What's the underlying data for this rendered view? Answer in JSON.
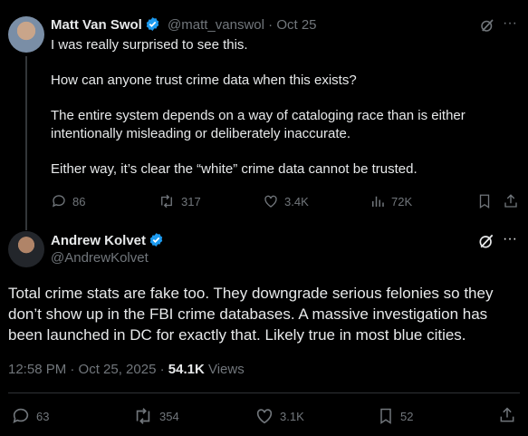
{
  "tweet1": {
    "name": "Matt Van Swol",
    "handle": "@matt_vanswol",
    "separator": "·",
    "date": "Oct 25",
    "body": [
      "I was really surprised to see this.",
      "How can anyone trust crime data when this exists?",
      "The entire system depends on a way of cataloging race than is either intentionally misleading or deliberately inaccurate.",
      "Either way, it’s clear the “white” crime data cannot be trusted."
    ],
    "replies": "86",
    "reposts": "317",
    "likes": "3.4K",
    "views": "72K"
  },
  "tweet2": {
    "name": "Andrew Kolvet",
    "handle": "@AndrewKolvet",
    "body": "Total crime stats are fake too. They downgrade serious felonies so they don’t show up in the FBI crime databases. A massive investigation has been launched in DC for exactly that. Likely true in most blue cities.",
    "time": "12:58 PM · Oct 25, 2025 ·",
    "views_count": "54.1K",
    "views_label": "Views",
    "replies": "63",
    "reposts": "354",
    "likes": "3.1K",
    "bookmarks": "52"
  },
  "colors": {
    "verified": "#1d9bf0",
    "muted": "#71767b",
    "text": "#e7e9ea",
    "background": "#000000"
  }
}
